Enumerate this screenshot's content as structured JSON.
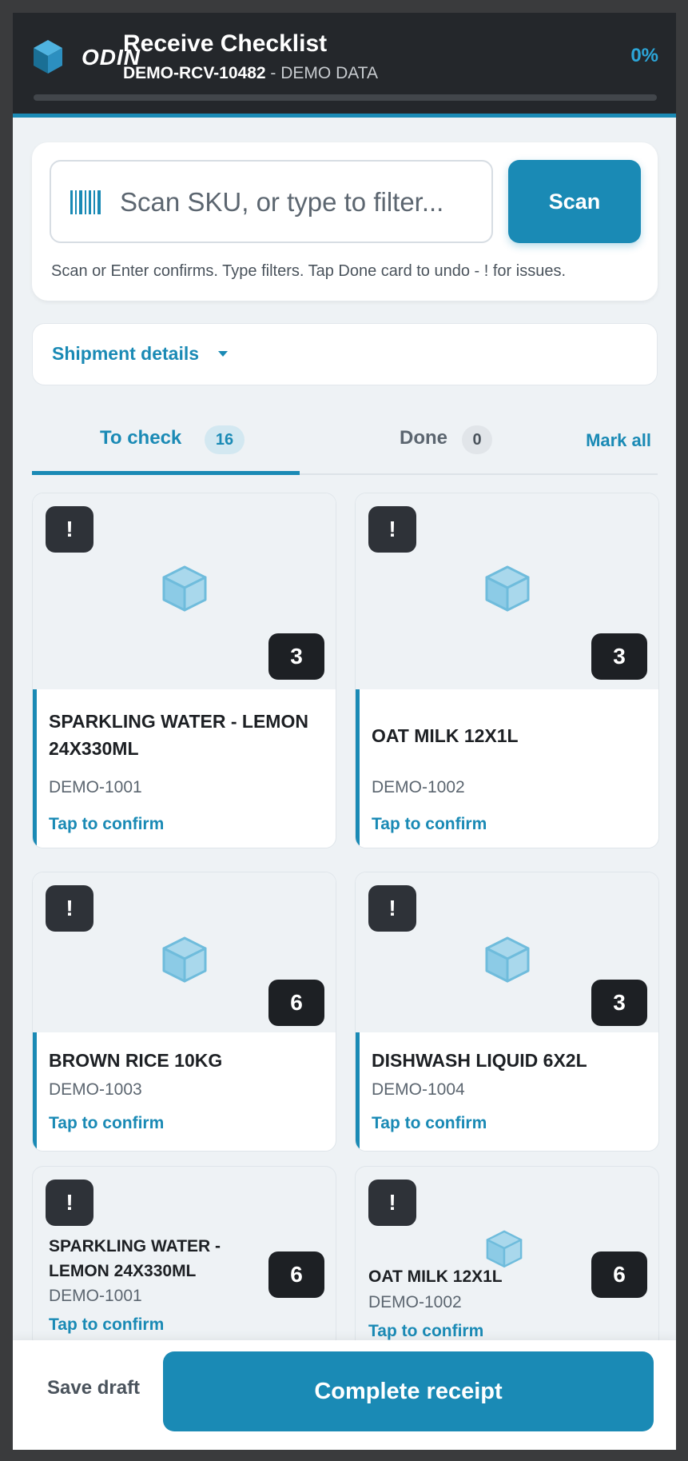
{
  "header": {
    "logo_text": "ODIN",
    "title": "Receive Checklist",
    "receipt_id": "DEMO-RCV-10482",
    "demo_note": "- DEMO DATA",
    "progress_label": "0%",
    "progress_fraction": 0
  },
  "scan": {
    "placeholder": "Scan SKU, or type to filter...",
    "button_label": "Scan",
    "hint": "Scan or Enter confirms. Type filters. Tap Done card to undo - ! for issues."
  },
  "shipment": {
    "label": "Shipment details"
  },
  "tabs": {
    "to_check": {
      "label": "To check",
      "count": "16"
    },
    "done": {
      "label": "Done",
      "count": "0"
    },
    "mark_all": "Mark all"
  },
  "items": [
    {
      "name": "SPARKLING WATER - LEMON 24X330ML",
      "sku": "DEMO-1001",
      "qty": "3",
      "action": "Tap to confirm",
      "warn": "!"
    },
    {
      "name": "OAT MILK 12X1L",
      "sku": "DEMO-1002",
      "qty": "3",
      "action": "Tap to confirm",
      "warn": "!"
    },
    {
      "name": "BROWN RICE 10KG",
      "sku": "DEMO-1003",
      "qty": "6",
      "action": "Tap to confirm",
      "warn": "!"
    },
    {
      "name": "DISHWASH LIQUID 6X2L",
      "sku": "DEMO-1004",
      "qty": "3",
      "action": "Tap to confirm",
      "warn": "!"
    },
    {
      "name": "SPARKLING WATER - LEMON 24X330ML",
      "sku": "DEMO-1001",
      "qty": "6",
      "action": "Tap to confirm",
      "warn": "!"
    },
    {
      "name": "OAT MILK 12X1L",
      "sku": "DEMO-1002",
      "qty": "6",
      "action": "Tap to confirm",
      "warn": "!"
    }
  ],
  "footer": {
    "save_label": "Save draft",
    "complete_label": "Complete receipt"
  },
  "colors": {
    "accent": "#1a8ab5",
    "header_bg": "#24272b",
    "badge_dark": "#1d2024"
  }
}
